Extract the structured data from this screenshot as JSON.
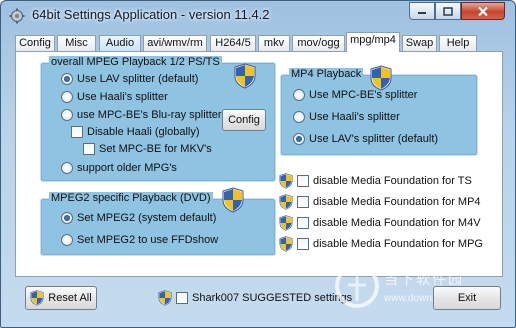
{
  "window": {
    "title": "64bit Settings Application - version 11.4.2"
  },
  "tabs": [
    "Config",
    "Misc",
    "Audio",
    "avi/wmv/rm",
    "H264/5",
    "mkv",
    "mov/ogg",
    "mpg/mp4",
    "Swap",
    "Help"
  ],
  "active_tab": "mpg/mp4",
  "mpeg_ps_group": {
    "title": "overall MPEG Playback 1/2 PS/TS",
    "options": [
      "Use LAV splitter (default)",
      "Use Haali's splitter",
      "use MPC-BE's Blu-ray splitter"
    ],
    "selected": "Use LAV splitter (default)",
    "sub_checks": [
      "Disable Haali (globally)",
      "Set MPC-BE for MKV's"
    ],
    "config_button": "Config",
    "older_option": "support older MPG's"
  },
  "mp4_group": {
    "title": "MP4 Playback",
    "options": [
      "Use MPC-BE's splitter",
      "Use Haali's splitter",
      "Use LAV's splitter (default)"
    ],
    "selected": "Use LAV's splitter (default)"
  },
  "mpeg2_group": {
    "title": "MPEG2 specific Playback (DVD)",
    "options": [
      "Set MPEG2 (system default)",
      "Set MPEG2 to use FFDshow"
    ],
    "selected": "Set MPEG2 (system default)"
  },
  "media_foundation": [
    "disable Media Foundation for TS",
    "disable Media Foundation for MP4",
    "disable Media Foundation for M4V",
    "disable Media Foundation for MPG"
  ],
  "footer": {
    "reset_label": "Reset All",
    "suggested_label": "Shark007 SUGGESTED settings",
    "exit_label": "Exit"
  },
  "watermark": {
    "text": "当下软件园",
    "url": "www.downxia.com"
  },
  "colors": {
    "group_bg": "#8ec3e2",
    "window_frame": "#b9d3ea",
    "close_button": "#c8442e"
  }
}
